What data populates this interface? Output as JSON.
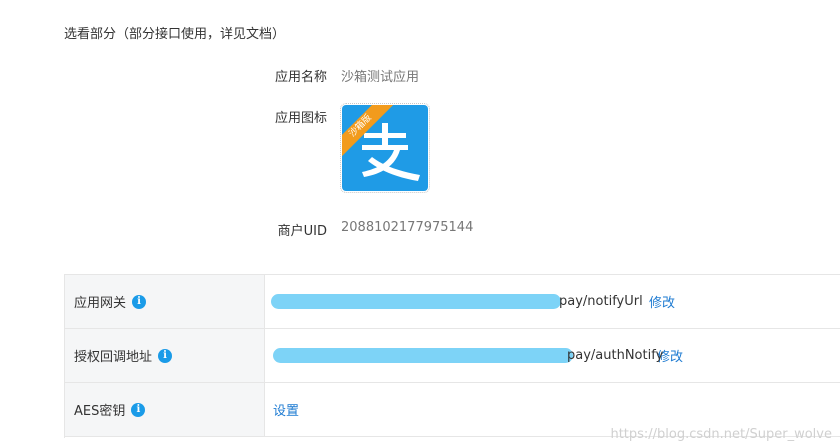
{
  "section_title": "选看部分（部分接口使用，详见文档）",
  "app_info": {
    "name_label": "应用名称",
    "name_value": "沙箱测试应用",
    "icon_label": "应用图标",
    "icon_badge": "沙箱版",
    "icon_glyph": "支",
    "uid_label": "商户UID",
    "uid_value": "2088102177975144"
  },
  "table": {
    "rows": [
      {
        "label": "应用网关",
        "info_icon": "i",
        "value": "http://                                                pay/notifyUrl",
        "value_tail": "pay/notifyUrl",
        "action": "修改"
      },
      {
        "label": "授权回调地址",
        "info_icon": "i",
        "value_tail": "pay/authNotify",
        "action": "修改"
      },
      {
        "label": "AES密钥",
        "info_icon": "i",
        "action": "设置"
      }
    ]
  },
  "watermark": "https://blog.csdn.net/Super_wolve",
  "colors": {
    "accent": "#1e7bd2",
    "alipay_blue": "#1f9be6",
    "ribbon": "#f29b1d",
    "redact": "#7dd3f7"
  }
}
